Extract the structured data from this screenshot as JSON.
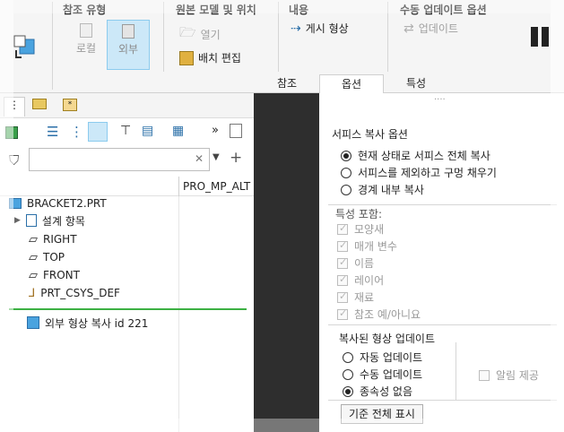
{
  "ribbon": {
    "groups": {
      "ref_type": "참조 유형",
      "source": "원본 모델 및 위치",
      "content": "내용",
      "manual": "수동 업데이트 옵션"
    },
    "buttons": {
      "local": "로컬",
      "external": "외부",
      "open": "열기",
      "place_edit": "배치 편집",
      "publish_geom": "게시 형상",
      "update": "업데이트"
    },
    "tabs": [
      "참조",
      "옵션",
      "특성"
    ],
    "active_tab": "옵션"
  },
  "tree": {
    "search": {
      "value": "",
      "placeholder": ""
    },
    "column_header": "PRO_MP_ALT",
    "items": {
      "root": "BRACKET2.PRT",
      "design_items": "설계 항목",
      "right": "RIGHT",
      "top": "TOP",
      "front": "FRONT",
      "csys": "PRT_CSYS_DEF",
      "ext_copy": "외부 형상 복사 id 221"
    }
  },
  "panel": {
    "dots": "····",
    "copy_options_title": "서피스 복사 옵션",
    "copy_options": [
      {
        "label": "현재 상태로 서피스 전체 복사",
        "checked": true
      },
      {
        "label": "서피스를 제외하고 구멍 채우기",
        "checked": false
      },
      {
        "label": "경계 내부 복사",
        "checked": false
      }
    ],
    "include_title": "특성 포함:",
    "include": [
      {
        "label": "모양새",
        "checked": true
      },
      {
        "label": "매개 변수",
        "checked": true
      },
      {
        "label": "이름",
        "checked": true
      },
      {
        "label": "레이어",
        "checked": true
      },
      {
        "label": "재료",
        "checked": true
      },
      {
        "label": "참조 예/아니요",
        "checked": true
      }
    ],
    "update_title": "복사된 형상 업데이트",
    "update_options": [
      {
        "label": "자동 업데이트",
        "checked": false
      },
      {
        "label": "수동 업데이트",
        "checked": false
      },
      {
        "label": "종속성 없음",
        "checked": true
      }
    ],
    "notify": "알림 제공",
    "show_ref": "기준 전체 표시"
  },
  "colors": {
    "accent_selected": "#cce8f8",
    "dark_gap": "#2e2e2e",
    "green_line": "#3cb043"
  }
}
